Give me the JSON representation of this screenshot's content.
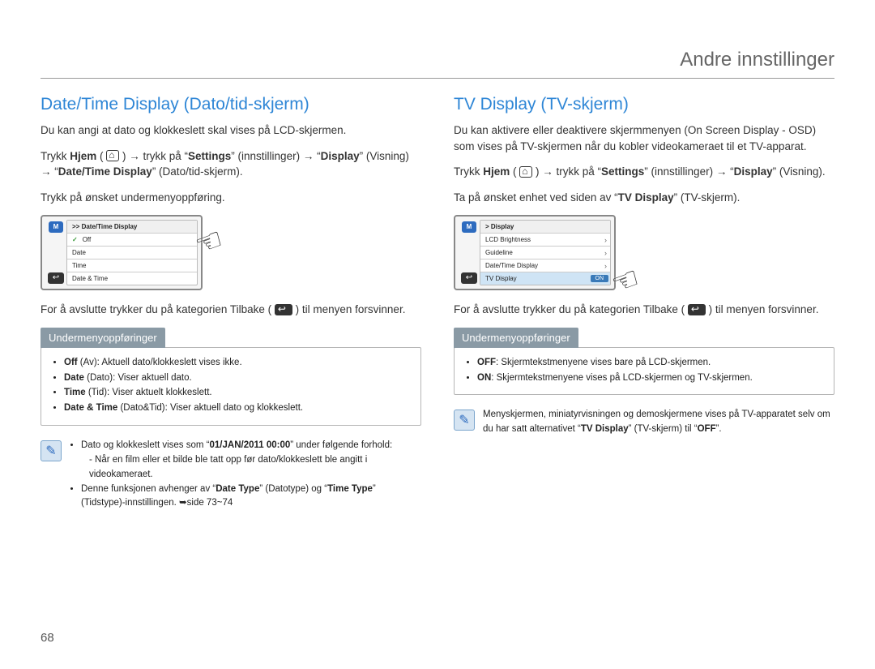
{
  "header": {
    "title": "Andre innstillinger"
  },
  "page_number": "68",
  "left": {
    "heading": "Date/Time Display (Dato/tid-skjerm)",
    "intro": "Du kan angi at dato og klokkeslett skal vises på LCD-skjermen.",
    "nav_pre": "Trykk ",
    "nav_hjem": "Hjem",
    "nav_mid1": " ( ",
    "nav_mid2": " ) → trykk på “",
    "nav_settings": "Settings",
    "nav_mid3": "” (innstillinger) → “",
    "nav_display": "Display",
    "nav_mid4": "” (Visning) → “",
    "nav_dtd": "Date/Time Display",
    "nav_end": "” (Dato/tid-skjerm).",
    "step": "Trykk på ønsket undermenyoppføring.",
    "lcd_title": ">> Date/Time Display",
    "lcd_items": [
      "Off",
      "Date",
      "Time",
      "Date & Time"
    ],
    "close_pre": "For å avslutte trykker du på kategorien Tilbake ( ",
    "close_post": " ) til menyen forsvinner.",
    "sub_heading": "Undermenyoppføringer",
    "sub_items": [
      {
        "b": "Off",
        "t": " (Av): Aktuell dato/klokkeslett vises ikke."
      },
      {
        "b": "Date",
        "t": " (Dato): Viser aktuell dato."
      },
      {
        "b": "Time",
        "t": " (Tid): Viser aktuelt klokkeslett."
      },
      {
        "b": "Date & Time",
        "t": " (Dato&Tid): Viser aktuell dato og klokkeslett."
      }
    ],
    "note1_a": "Dato og klokkeslett vises som “",
    "note1_bold": "01/JAN/2011 00:00",
    "note1_b": "” under følgende forhold:",
    "note1_sub": "- Når en film eller et bilde ble tatt opp før dato/klokkeslett ble angitt i videokameraet.",
    "note2_a": "Denne funksjonen avhenger av “",
    "note2_b1": "Date Type",
    "note2_c": "” (Datotype) og “",
    "note2_b2": "Time Type",
    "note2_d": "” (Tidstype)-innstillingen. ➥side 73~74"
  },
  "right": {
    "heading": "TV Display (TV-skjerm)",
    "intro": "Du kan aktivere eller deaktivere skjermmenyen (On Screen Display - OSD) som vises på TV-skjermen når du kobler videokameraet til et TV-apparat.",
    "nav_pre": "Trykk ",
    "nav_hjem": "Hjem",
    "nav_mid1": " ( ",
    "nav_mid2": " ) → trykk på “",
    "nav_settings": "Settings",
    "nav_mid3": "” (innstillinger) → “",
    "nav_display": "Display",
    "nav_end": "” (Visning).",
    "step_a": "Ta på ønsket enhet ved siden av “",
    "step_b": "TV Display",
    "step_c": "” (TV-skjerm).",
    "lcd_title": "> Display",
    "lcd_items": [
      "LCD Brightness",
      "Guideline",
      "Date/Time Display",
      "TV Display"
    ],
    "on_label": "ON",
    "close_pre": "For å avslutte trykker du på kategorien Tilbake ( ",
    "close_post": " ) til menyen forsvinner.",
    "sub_heading": "Undermenyoppføringer",
    "sub_items": [
      {
        "b": "OFF",
        "t": ": Skjermtekstmenyene vises bare på LCD-skjermen."
      },
      {
        "b": "ON",
        "t": ": Skjermtekstmenyene vises på LCD-skjermen og TV-skjermen."
      }
    ],
    "note_a": "Menyskjermen, miniatyrvisningen og demoskjermene vises på TV-apparatet selv om du har satt alternativet “",
    "note_b": "TV Display",
    "note_c": "” (TV-skjerm) til “",
    "note_d": "OFF",
    "note_e": "”."
  }
}
